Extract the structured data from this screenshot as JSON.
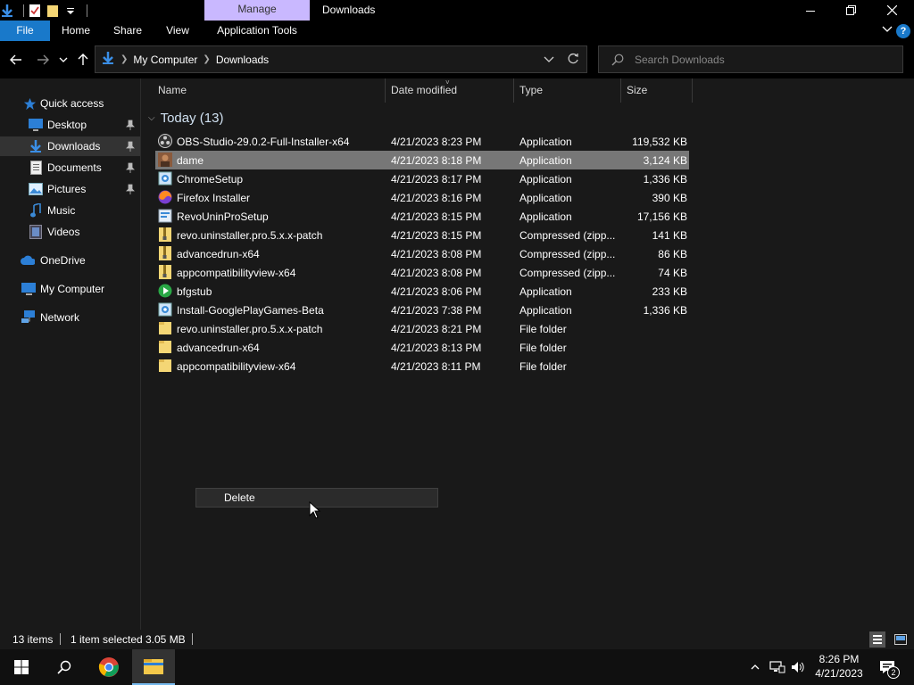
{
  "titlebar": {
    "context_tab": "Manage",
    "window_title": "Downloads"
  },
  "ribbon": {
    "tabs": [
      "File",
      "Home",
      "Share",
      "View",
      "Application Tools"
    ],
    "help": "?"
  },
  "address": {
    "crumbs": [
      "My Computer",
      "Downloads"
    ]
  },
  "search": {
    "placeholder": "Search Downloads"
  },
  "nav": {
    "items": [
      {
        "label": "Quick access",
        "icon": "star-icon"
      },
      {
        "label": "Desktop",
        "icon": "desktop-icon"
      },
      {
        "label": "Downloads",
        "icon": "download-icon"
      },
      {
        "label": "Documents",
        "icon": "document-icon"
      },
      {
        "label": "Pictures",
        "icon": "pictures-icon"
      },
      {
        "label": "Music",
        "icon": "music-icon"
      },
      {
        "label": "Videos",
        "icon": "videos-icon"
      },
      {
        "label": "OneDrive",
        "icon": "cloud-icon"
      },
      {
        "label": "My Computer",
        "icon": "computer-icon"
      },
      {
        "label": "Network",
        "icon": "network-icon"
      }
    ]
  },
  "columns": {
    "name": "Name",
    "date": "Date modified",
    "type": "Type",
    "size": "Size"
  },
  "group": {
    "label": "Today (13)"
  },
  "files": [
    {
      "name": "OBS-Studio-29.0.2-Full-Installer-x64",
      "date": "4/21/2023 8:23 PM",
      "type": "Application",
      "size": "119,532 KB",
      "icon": "obs-icon"
    },
    {
      "name": "dame",
      "date": "4/21/2023 8:18 PM",
      "type": "Application",
      "size": "3,124 KB",
      "icon": "photo-app-icon"
    },
    {
      "name": "ChromeSetup",
      "date": "4/21/2023 8:17 PM",
      "type": "Application",
      "size": "1,336 KB",
      "icon": "installer-icon"
    },
    {
      "name": "Firefox Installer",
      "date": "4/21/2023 8:16 PM",
      "type": "Application",
      "size": "390 KB",
      "icon": "firefox-icon"
    },
    {
      "name": "RevoUninProSetup",
      "date": "4/21/2023 8:15 PM",
      "type": "Application",
      "size": "17,156 KB",
      "icon": "setup-icon"
    },
    {
      "name": "revo.uninstaller.pro.5.x.x-patch",
      "date": "4/21/2023 8:15 PM",
      "type": "Compressed (zipp...",
      "size": "141 KB",
      "icon": "zip-icon"
    },
    {
      "name": "advancedrun-x64",
      "date": "4/21/2023 8:08 PM",
      "type": "Compressed (zipp...",
      "size": "86 KB",
      "icon": "zip-icon"
    },
    {
      "name": "appcompatibilityview-x64",
      "date": "4/21/2023 8:08 PM",
      "type": "Compressed (zipp...",
      "size": "74 KB",
      "icon": "zip-icon"
    },
    {
      "name": "bfgstub",
      "date": "4/21/2023 8:06 PM",
      "type": "Application",
      "size": "233 KB",
      "icon": "green-play-icon"
    },
    {
      "name": "Install-GooglePlayGames-Beta",
      "date": "4/21/2023 7:38 PM",
      "type": "Application",
      "size": "1,336 KB",
      "icon": "installer-icon"
    },
    {
      "name": "revo.uninstaller.pro.5.x.x-patch",
      "date": "4/21/2023 8:21 PM",
      "type": "File folder",
      "size": "",
      "icon": "folder-icon"
    },
    {
      "name": "advancedrun-x64",
      "date": "4/21/2023 8:13 PM",
      "type": "File folder",
      "size": "",
      "icon": "folder-icon"
    },
    {
      "name": "appcompatibilityview-x64",
      "date": "4/21/2023 8:11 PM",
      "type": "File folder",
      "size": "",
      "icon": "folder-icon"
    }
  ],
  "context_menu": {
    "delete_label": "Delete"
  },
  "status": {
    "items_count": "13 items",
    "selection": "1 item selected",
    "size": "3.05 MB"
  },
  "clock": {
    "time": "8:26 PM",
    "date": "4/21/2023"
  },
  "notifications": {
    "count": "2"
  },
  "colors": {
    "accent": "#1979ca",
    "context_tab": "#c9b8ff",
    "selected_row": "#777777",
    "folder": "#f4d675"
  }
}
